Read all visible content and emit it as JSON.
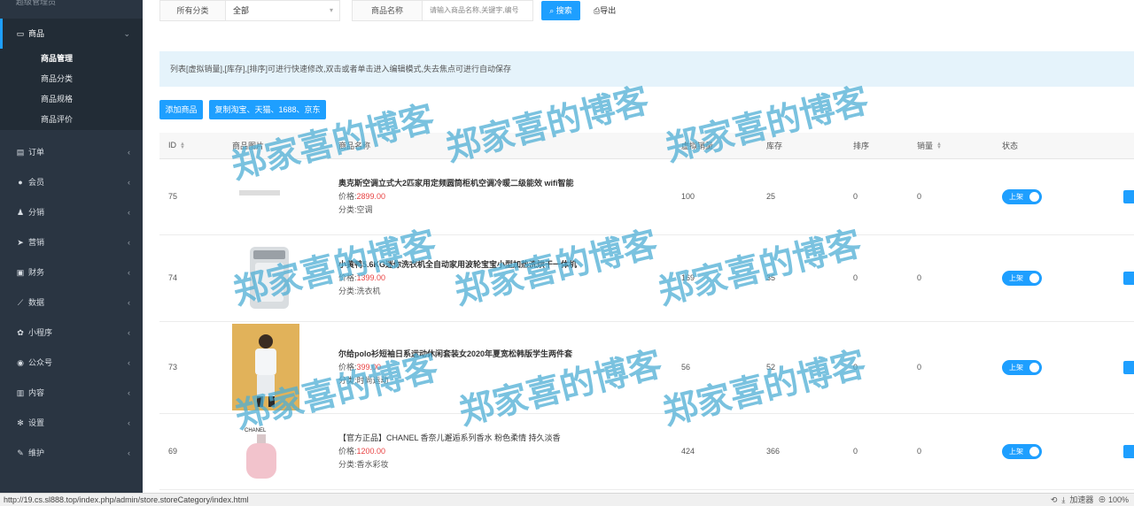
{
  "sidebar": {
    "top_label": "超级管理员",
    "goods": {
      "label": "商品",
      "items": [
        "商品管理",
        "商品分类",
        "商品规格",
        "商品评价"
      ]
    },
    "menu": [
      {
        "label": "订单",
        "icon": "document-icon"
      },
      {
        "label": "会员",
        "icon": "user-icon"
      },
      {
        "label": "分销",
        "icon": "distribution-icon"
      },
      {
        "label": "营销",
        "icon": "send-icon"
      },
      {
        "label": "财务",
        "icon": "money-icon"
      },
      {
        "label": "数据",
        "icon": "chart-icon"
      },
      {
        "label": "小程序",
        "icon": "miniprogram-icon"
      },
      {
        "label": "公众号",
        "icon": "wechat-icon"
      },
      {
        "label": "内容",
        "icon": "book-icon"
      },
      {
        "label": "设置",
        "icon": "gear-icon"
      },
      {
        "label": "维护",
        "icon": "wrench-icon"
      }
    ]
  },
  "search": {
    "category_label": "所有分类",
    "category_value": "全部",
    "name_label": "商品名称",
    "name_placeholder": "请输入商品名称,关键字,编号",
    "search_btn": "搜索",
    "export_btn": "导出"
  },
  "notice": "列表[虚拟销量],[库存],[排序]可进行快速修改,双击或者单击进入编辑模式,失去焦点可进行自动保存",
  "actions": {
    "add": "添加商品",
    "copy": "复制淘宝、天猫、1688、京东"
  },
  "table": {
    "headers": [
      "ID",
      "商品图片",
      "商品名称",
      "虚拟销量",
      "库存",
      "排序",
      "销量",
      "状态"
    ],
    "price_prefix": "价格:",
    "cat_prefix": "分类:",
    "rows": [
      {
        "id": "75",
        "name": "奥克斯空调立式大2匹家用定频圆筒柜机空调冷暖二级能效 wifi智能",
        "price": "2899.00",
        "category": "空调",
        "virtual_sales": "100",
        "stock": "25",
        "sort": "0",
        "sales": "0",
        "status": "上架"
      },
      {
        "id": "74",
        "name": "小黄鸭5.6KG迷你洗衣机全自动家用波轮宝宝小型加热洗烘干一体机",
        "price": "1399.00",
        "category": "洗衣机",
        "virtual_sales": "169",
        "stock": "35",
        "sort": "0",
        "sales": "0",
        "status": "上架"
      },
      {
        "id": "73",
        "name": "尔给polo衫短袖日系运动休闲套装女2020年夏宽松韩版学生两件套",
        "price": "399.00",
        "category": "时尚运动",
        "virtual_sales": "56",
        "stock": "52",
        "sort": "0",
        "sales": "0",
        "status": "上架"
      },
      {
        "id": "69",
        "name": "【官方正品】CHANEL 香奈儿邂逅系列香水 粉色柔情 持久淡香",
        "price": "1200.00",
        "category": "香水彩妆",
        "virtual_sales": "424",
        "stock": "366",
        "sort": "0",
        "sales": "0",
        "status": "上架"
      }
    ],
    "perfume_brand": "CHANEL"
  },
  "watermark": "郑家喜的博客",
  "statusbar": {
    "url": "http://19.cs.sl888.top/index.php/admin/store.storeCategory/index.html",
    "accelerator": "加速器",
    "zoom": "100%"
  }
}
